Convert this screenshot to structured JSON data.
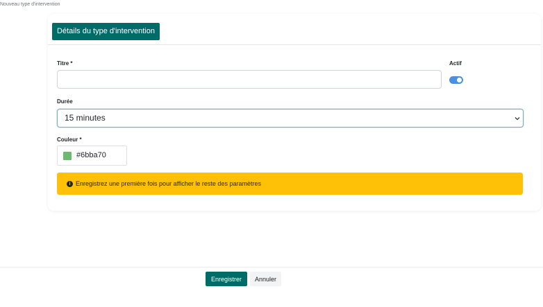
{
  "breadcrumb": "Nouveau type d'intervention",
  "tab": {
    "label": "Détails du type d'intervention"
  },
  "form": {
    "title": {
      "label": "Titre *",
      "value": ""
    },
    "active": {
      "label": "Actif",
      "checked": true
    },
    "duration": {
      "label": "Durée",
      "value": "15 minutes",
      "icon": "chevron-down-icon"
    },
    "color": {
      "label": "Couleur *",
      "value": "#6bba70"
    }
  },
  "alert": {
    "icon": "info-icon",
    "icon_glyph": "i",
    "text": "Enregistrez une première fois pour afficher le reste des paramètres",
    "background": "#ffc107"
  },
  "footer": {
    "save_label": "Enregistrer",
    "cancel_label": "Annuler"
  },
  "colors": {
    "primary": "#006c68",
    "toggle": "#4a90e2",
    "swatch": "#6bba70"
  }
}
